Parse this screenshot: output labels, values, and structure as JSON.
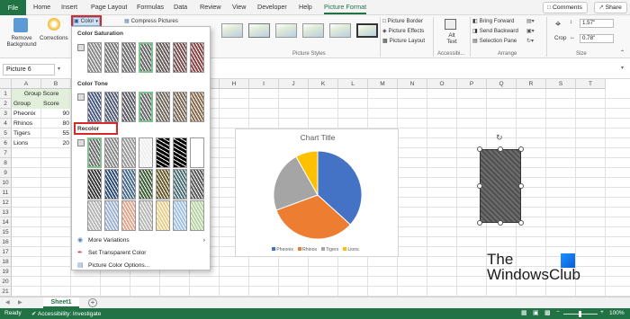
{
  "tabs": [
    "File",
    "Home",
    "Insert",
    "Page Layout",
    "Formulas",
    "Data",
    "Review",
    "View",
    "Developer",
    "Help",
    "Picture Format"
  ],
  "top": {
    "comments": "Comments",
    "share": "Share"
  },
  "ribbon": {
    "remove_bg": "Remove Background",
    "corrections": "Corrections",
    "color": "Color",
    "compress": "Compress Pictures",
    "picture_border": "Picture Border",
    "picture_effects": "Picture Effects",
    "picture_layout": "Picture Layout",
    "alt_text": "Alt Text",
    "bring_forward": "Bring Forward",
    "send_backward": "Send Backward",
    "selection_pane": "Selection Pane",
    "crop": "Crop",
    "height": "1.57\"",
    "width": "0.78\"",
    "groups": {
      "styles": "Picture Styles",
      "access": "Accessibi...",
      "arrange": "Arrange",
      "size": "Size"
    }
  },
  "namebox": "Picture 6",
  "columns": [
    "A",
    "B",
    "C",
    "D",
    "E",
    "F",
    "G",
    "H",
    "I",
    "J",
    "K",
    "L",
    "M",
    "N",
    "O",
    "P",
    "Q",
    "R",
    "S",
    "T"
  ],
  "rows": [
    "1",
    "2",
    "3",
    "4",
    "5",
    "6",
    "7",
    "8",
    "9",
    "10",
    "11",
    "12",
    "13",
    "14",
    "15",
    "16",
    "17",
    "18",
    "19",
    "20",
    "21"
  ],
  "cells": {
    "title": "Group Score",
    "h1": "Group",
    "h2": "Score",
    "data": [
      [
        "Pheonix",
        "90"
      ],
      [
        "Rhinos",
        "80"
      ],
      [
        "Tigers",
        "55"
      ],
      [
        "Lions",
        "20"
      ]
    ]
  },
  "dropdown": {
    "sat": "Color Saturation",
    "tone": "Color Tone",
    "recolor": "Recolor",
    "more": "More Variations",
    "transparent": "Set Transparent Color",
    "options": "Picture Color Options..."
  },
  "chart_data": {
    "type": "pie",
    "title": "Chart Title",
    "categories": [
      "Pheonix",
      "Rhinos",
      "Tigers",
      "Lions"
    ],
    "values": [
      90,
      80,
      55,
      20
    ],
    "colors": [
      "#4472c4",
      "#ed7d31",
      "#a5a5a5",
      "#ffc000"
    ],
    "legend": "bottom"
  },
  "sheet_tab": "Sheet1",
  "status": {
    "ready": "Ready",
    "access": "Accessibility: Investigate",
    "zoom": "100%"
  },
  "watermark": {
    "line1": "The",
    "line2": "WindowsClub"
  }
}
